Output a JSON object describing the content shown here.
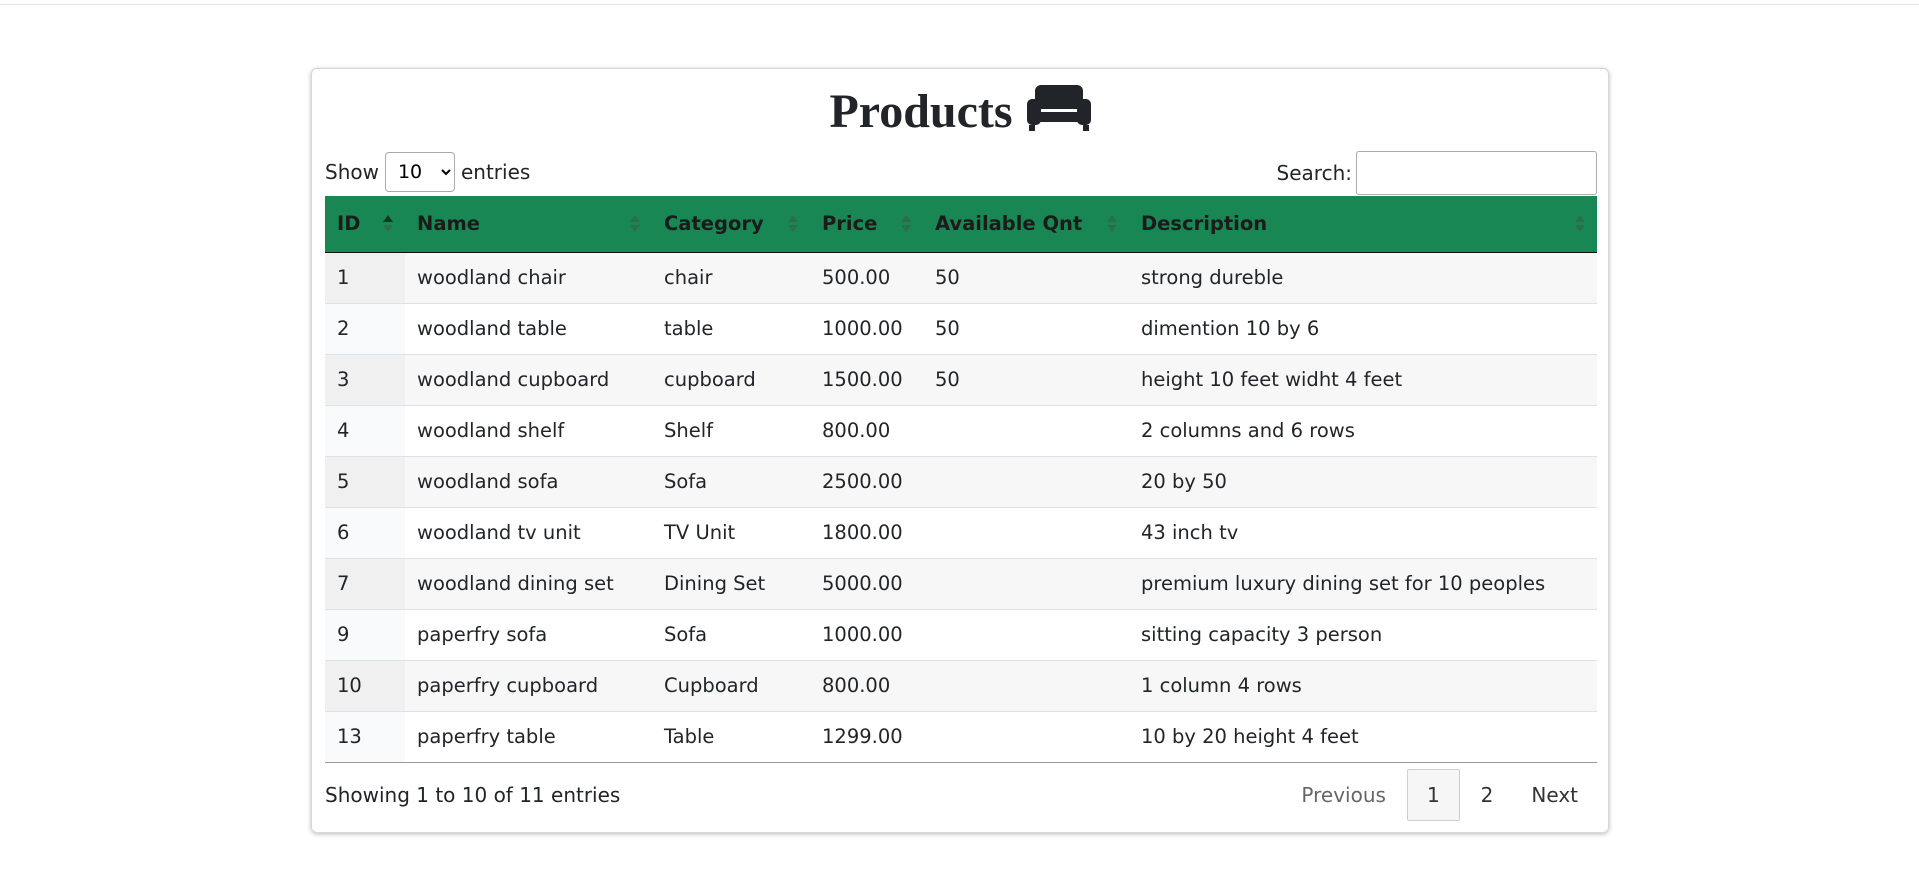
{
  "page": {
    "title": "Products",
    "title_icon": "sofa-icon"
  },
  "controls": {
    "show_label": "Show",
    "entries_label": "entries",
    "page_length": "10",
    "page_length_options": [
      "10"
    ],
    "search_label": "Search:",
    "search_value": ""
  },
  "table": {
    "header_color": "#198754",
    "columns": [
      {
        "label": "ID",
        "sort": "asc"
      },
      {
        "label": "Name",
        "sort": "none"
      },
      {
        "label": "Category",
        "sort": "none"
      },
      {
        "label": "Price",
        "sort": "none"
      },
      {
        "label": "Available Qnt",
        "sort": "none"
      },
      {
        "label": "Description",
        "sort": "none"
      }
    ],
    "rows": [
      [
        "1",
        "woodland chair",
        "chair",
        "500.00",
        "50",
        "strong dureble"
      ],
      [
        "2",
        "woodland table",
        "table",
        "1000.00",
        "50",
        "dimention 10 by 6"
      ],
      [
        "3",
        "woodland cupboard",
        "cupboard",
        "1500.00",
        "50",
        "height 10 feet widht 4 feet"
      ],
      [
        "4",
        "woodland shelf",
        "Shelf",
        "800.00",
        "",
        "2 columns and 6 rows"
      ],
      [
        "5",
        "woodland sofa",
        "Sofa",
        "2500.00",
        "",
        "20 by 50"
      ],
      [
        "6",
        "woodland tv unit",
        "TV Unit",
        "1800.00",
        "",
        "43 inch tv"
      ],
      [
        "7",
        "woodland dining set",
        "Dining Set",
        "5000.00",
        "",
        "premium luxury dining set for 10 peoples"
      ],
      [
        "9",
        "paperfry sofa",
        "Sofa",
        "1000.00",
        "",
        "sitting capacity 3 person"
      ],
      [
        "10",
        "paperfry cupboard",
        "Cupboard",
        "800.00",
        "",
        "1 column 4 rows"
      ],
      [
        "13",
        "paperfry table",
        "Table",
        "1299.00",
        "",
        "10 by 20 height 4 feet"
      ]
    ]
  },
  "footer": {
    "info": "Showing 1 to 10 of 11 entries",
    "previous": "Previous",
    "pages": [
      "1",
      "2"
    ],
    "current_page": "1",
    "next": "Next"
  }
}
